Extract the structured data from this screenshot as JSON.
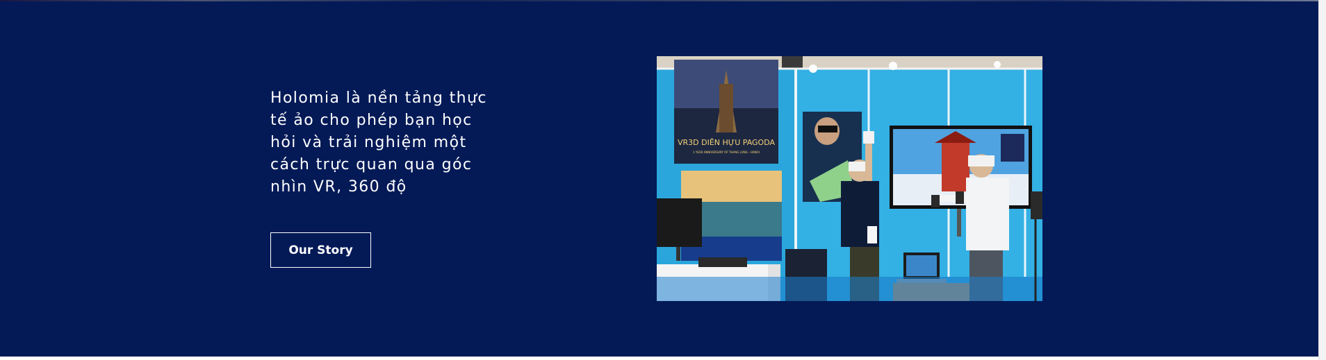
{
  "hero": {
    "tagline": "Holomia là nền tảng thực tế ảo cho phép bạn học hỏi và trải nghiệm một cách trực quan qua góc nhìn VR, 360 độ",
    "cta_label": "Our Story",
    "background_color": "#041a57"
  },
  "photo": {
    "banner_title": "VR3D DIÊN HỰU PAGODA",
    "banner_subtitle": "1 YEAR ANNIVERSARY OF THANG LONG - HANOI"
  }
}
